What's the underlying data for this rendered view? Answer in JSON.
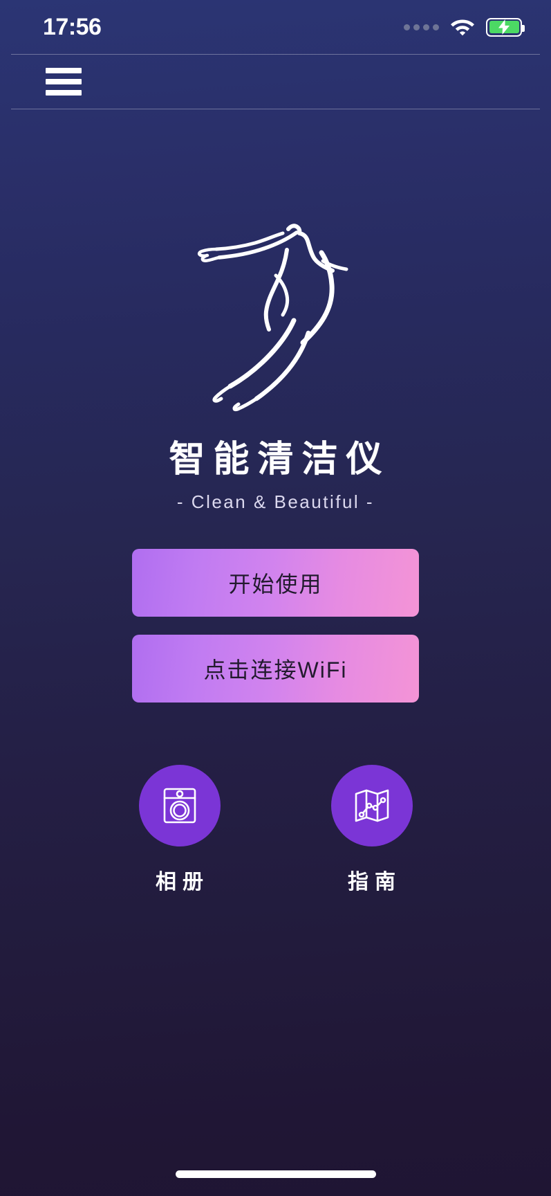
{
  "status_bar": {
    "time": "17:56",
    "signal_icon": "signal-dots-icon",
    "signal_dots": 4,
    "wifi_icon": "wifi-icon",
    "battery_icon": "battery-charging-icon",
    "battery_charging": true,
    "battery_color": "#4cd964"
  },
  "nav": {
    "menu_icon": "hamburger-menu-icon"
  },
  "hero": {
    "logo_icon": "dancer-line-art-logo",
    "title": "智能清洁仪",
    "subtitle": "- Clean & Beautiful -"
  },
  "actions": {
    "primary_label": "开始使用",
    "secondary_label": "点击连接WiFi",
    "gradient_start": "#b06ef0",
    "gradient_end": "#f494d6"
  },
  "shortcuts": [
    {
      "id": "album",
      "label": "相册",
      "icon": "washing-machine-icon",
      "circle_color": "#7b35d6"
    },
    {
      "id": "guide",
      "label": "指南",
      "icon": "folded-map-icon",
      "circle_color": "#7b35d6"
    }
  ],
  "background": {
    "top_color": "#2b3574",
    "bottom_color": "#1f1533"
  }
}
